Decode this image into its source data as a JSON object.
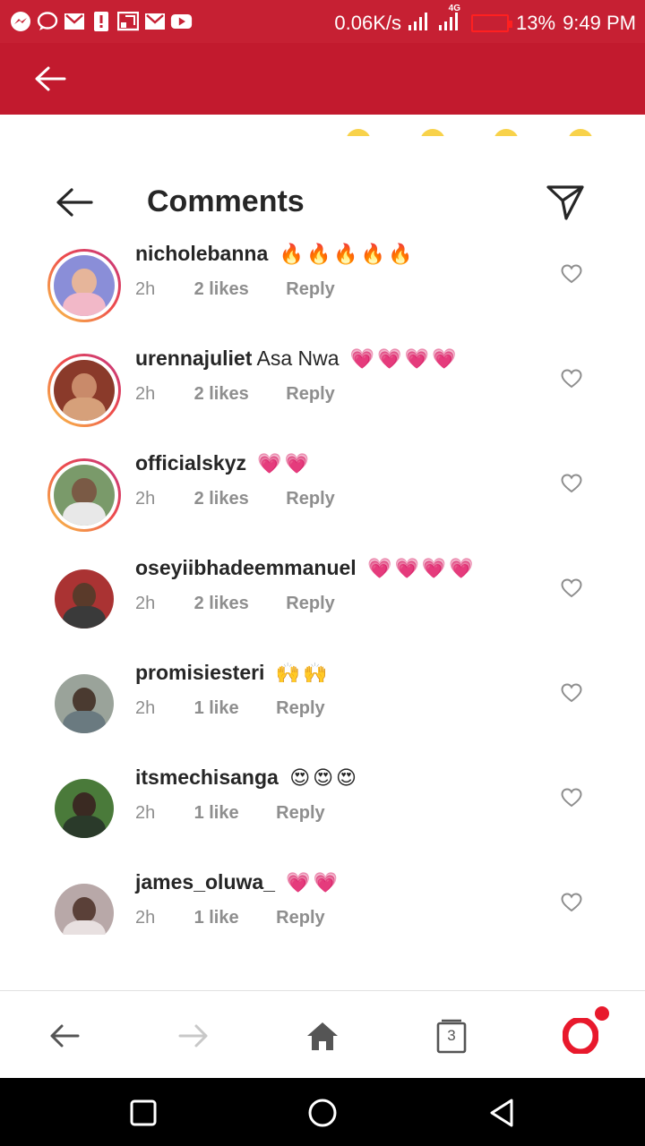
{
  "status_bar": {
    "net_speed": "0.06K/s",
    "network": "4G",
    "battery_percent": "13%",
    "battery_level": 0.13,
    "time": "9:49 PM",
    "notification_icons": [
      "messenger-icon",
      "chat-icon",
      "gmail-icon",
      "alert-icon",
      "cast-icon",
      "gmail-icon",
      "youtube-icon"
    ]
  },
  "colors": {
    "status_bar_bg": "#c62033",
    "app_bar_bg": "#c21a2e",
    "username_text": "#262626",
    "meta_text": "#8e8e8e",
    "opera_red": "#e8192c"
  },
  "header": {
    "title": "Comments"
  },
  "comments": [
    {
      "username": "nicholebanna",
      "text": "",
      "emoji": "🔥🔥🔥🔥🔥",
      "time": "2h",
      "likes": "2 likes",
      "reply": "Reply",
      "story_ring": true
    },
    {
      "username": "urennajuliet",
      "text": "Asa Nwa",
      "emoji": "💗💗💗💗",
      "time": "2h",
      "likes": "2 likes",
      "reply": "Reply",
      "story_ring": true
    },
    {
      "username": "officialskyz",
      "text": "",
      "emoji": "💗💗",
      "time": "2h",
      "likes": "2 likes",
      "reply": "Reply",
      "story_ring": true
    },
    {
      "username": "oseyiibhadeemmanuel",
      "text": "",
      "emoji": "💗💗💗💗",
      "time": "2h",
      "likes": "2 likes",
      "reply": "Reply",
      "story_ring": false
    },
    {
      "username": "promisiesteri",
      "text": "",
      "emoji": "🙌🙌",
      "time": "2h",
      "likes": "1 like",
      "reply": "Reply",
      "story_ring": false
    },
    {
      "username": "itsmechisanga",
      "text": "",
      "emoji": "😍😍😍",
      "time": "2h",
      "likes": "1 like",
      "reply": "Reply",
      "story_ring": false
    },
    {
      "username": "james_oluwa_",
      "text": "",
      "emoji": "💗💗",
      "time": "2h",
      "likes": "1 like",
      "reply": "Reply",
      "story_ring": false
    }
  ],
  "browser_bar": {
    "tab_count": "3"
  }
}
